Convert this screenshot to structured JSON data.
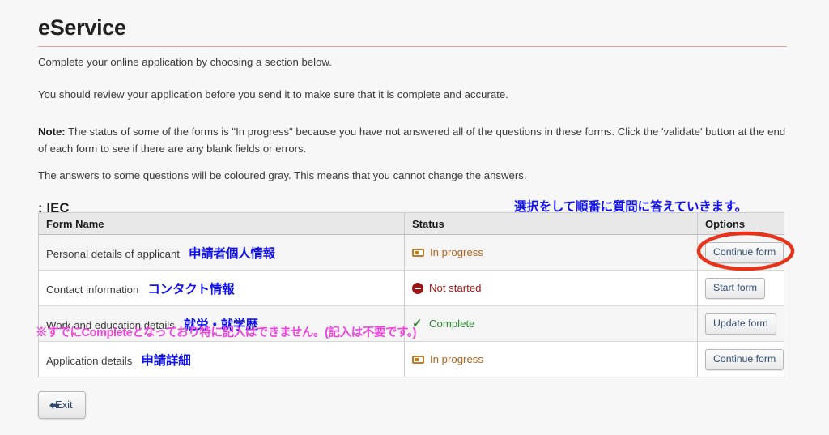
{
  "header": {
    "app_title": "eService",
    "rule_color": "#d9a3a3"
  },
  "intro": {
    "line1": "Complete your online application by choosing a section below.",
    "line2": "You should review your application before you send it to make sure that it is complete and accurate."
  },
  "note": {
    "label": "Note:",
    "body": " The status of some of the forms is \"In progress\" because you have not answered all of the questions in these forms. Click the 'validate' button at the end of each form to see if there are any blank fields or errors.",
    "gray_answers": "The answers to some questions will be coloured gray. This means that you cannot change the answers."
  },
  "section": {
    "title": ": IEC"
  },
  "annotations": {
    "blue_top": "選択をして順番に質問に答えていきます。",
    "blue_color": "#1111ee",
    "pink_note": "※すでにCompleteとなっており特に記入はできません。(記入は不要です。)",
    "pink_color": "#ee44dd",
    "ellipse_color": "#e8331c"
  },
  "table": {
    "columns": {
      "name": "Form Name",
      "status": "Status",
      "options": "Options"
    },
    "rows": [
      {
        "name_en": "Personal details of applicant",
        "name_jp": "申請者個人情報",
        "status": "In progress",
        "status_kind": "inprogress",
        "button": "Continue form",
        "highlighted": true
      },
      {
        "name_en": "Contact information",
        "name_jp": "コンタクト情報",
        "status": "Not started",
        "status_kind": "notstarted",
        "button": "Start form",
        "highlighted": false
      },
      {
        "name_en": "Work and education details",
        "name_jp": "就労・就学歴",
        "status": "Complete",
        "status_kind": "complete",
        "button": "Update form",
        "highlighted": false
      },
      {
        "name_en": "Application details",
        "name_jp": "申請詳細",
        "status": "In progress",
        "status_kind": "inprogress",
        "button": "Continue form",
        "highlighted": false
      }
    ]
  },
  "footer": {
    "exit_label": "Exit"
  },
  "status_colors": {
    "in_progress": "#b5651d",
    "not_started": "#a81818",
    "complete": "#2e8b2e"
  }
}
